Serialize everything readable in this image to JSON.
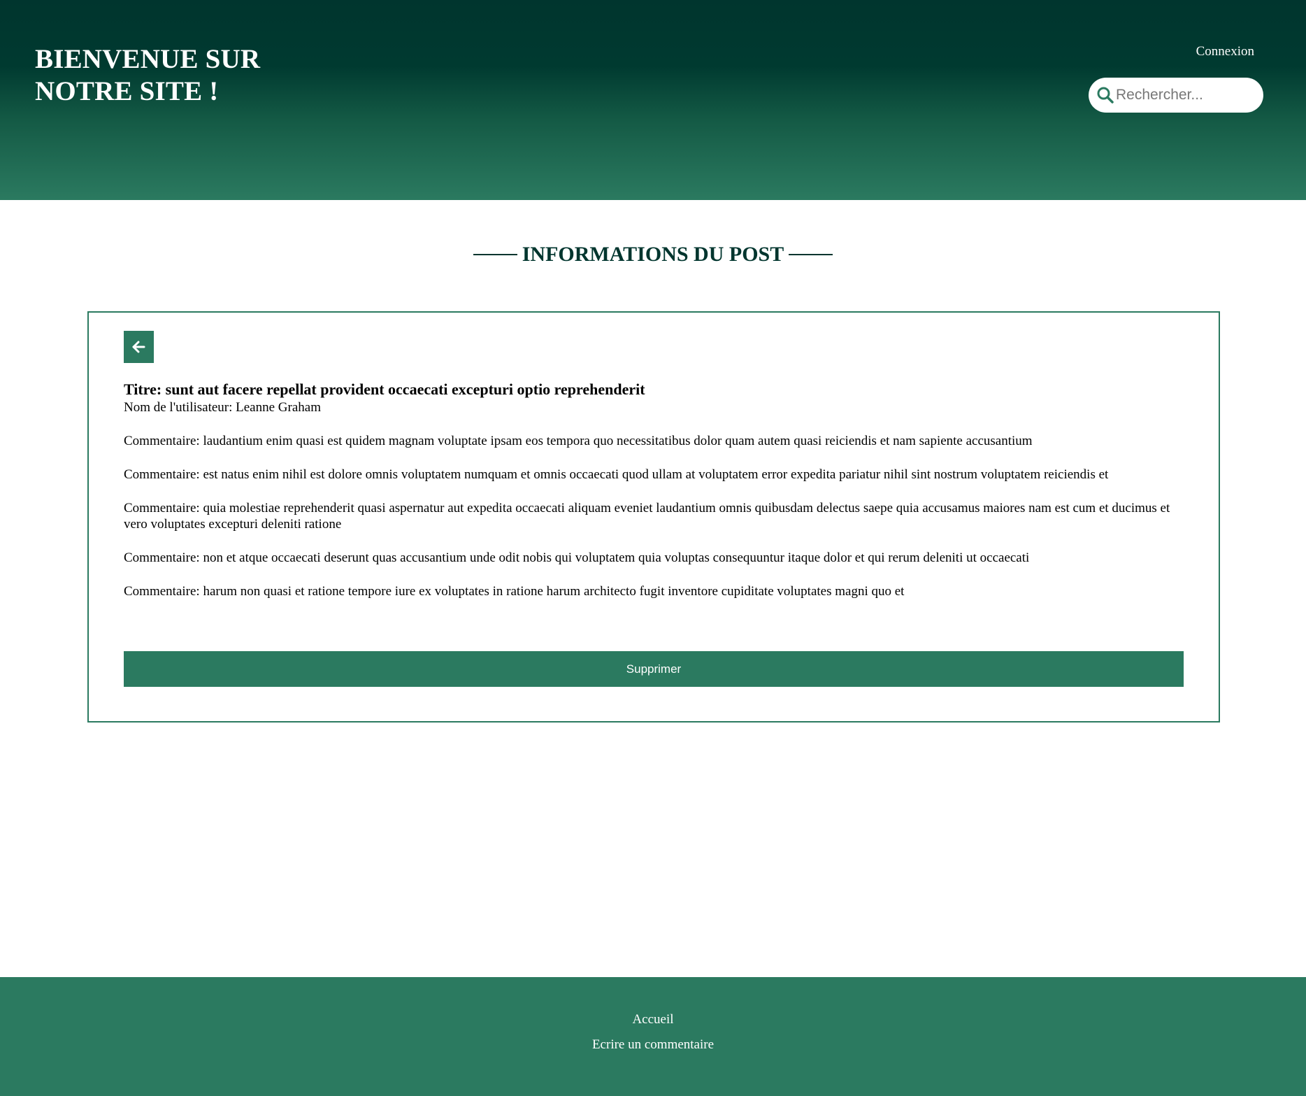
{
  "header": {
    "title_line1": "BIENVENUE SUR",
    "title_line2": "NOTRE SITE !",
    "login_label": "Connexion",
    "search_placeholder": "Rechercher...",
    "search_icon": "search-icon"
  },
  "main": {
    "section_title": "INFORMATIONS DU POST",
    "back_icon": "arrow-left-icon",
    "post": {
      "title": "Titre: sunt aut facere repellat provident occaecati excepturi optio reprehenderit",
      "author": "Nom de l'utilisateur: Leanne Graham",
      "comments": [
        "Commentaire: laudantium enim quasi est quidem magnam voluptate ipsam eos tempora quo necessitatibus dolor quam autem quasi reiciendis et nam sapiente accusantium",
        "Commentaire: est natus enim nihil est dolore omnis voluptatem numquam et omnis occaecati quod ullam at voluptatem error expedita pariatur nihil sint nostrum voluptatem reiciendis et",
        "Commentaire: quia molestiae reprehenderit quasi aspernatur aut expedita occaecati aliquam eveniet laudantium omnis quibusdam delectus saepe quia accusamus maiores nam est cum et ducimus et vero voluptates excepturi deleniti ratione",
        "Commentaire: non et atque occaecati deserunt quas accusantium unde odit nobis qui voluptatem quia voluptas consequuntur itaque dolor et qui rerum deleniti ut occaecati",
        "Commentaire: harum non quasi et ratione tempore iure ex voluptates in ratione harum architecto fugit inventore cupiditate voluptates magni quo et"
      ]
    },
    "delete_label": "Supprimer"
  },
  "footer": {
    "home_label": "Accueil",
    "write_label": "Ecrire un commentaire"
  },
  "colors": {
    "header_dark": "#00352e",
    "accent_green": "#2b7a60"
  }
}
